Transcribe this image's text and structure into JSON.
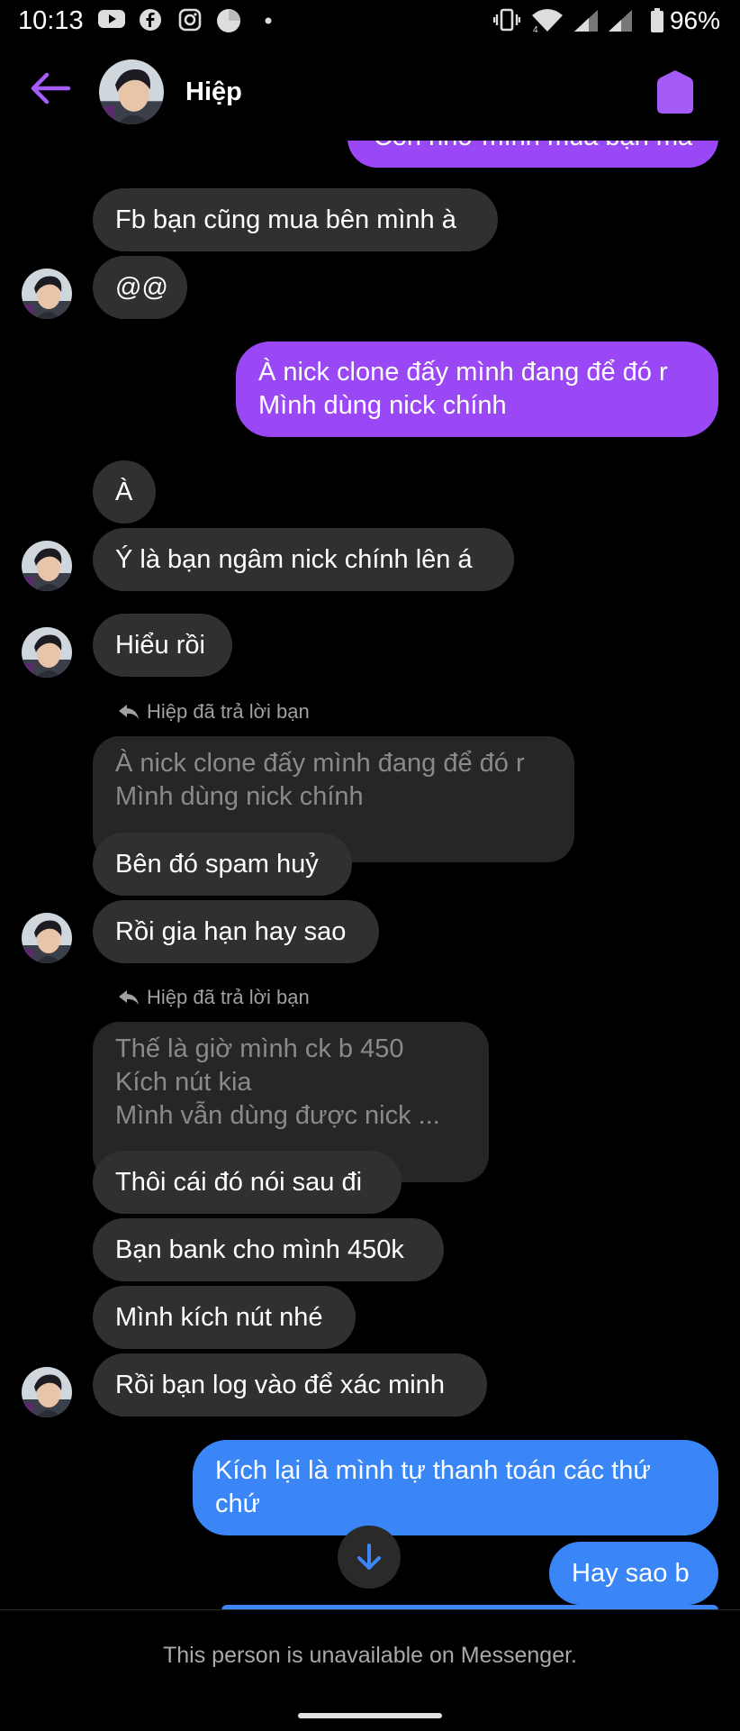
{
  "status_bar": {
    "time": "10:13",
    "battery": "96%",
    "icons": [
      "youtube-icon",
      "facebook-icon",
      "instagram-icon",
      "circle-icon",
      "dot-icon",
      "vibrate-icon",
      "wifi-icon",
      "signal-icon",
      "signal-icon",
      "battery-icon"
    ]
  },
  "header": {
    "contact_name": "Hiệp"
  },
  "top_partial": {
    "text": "Còn nhờ mình mua bạn mà"
  },
  "messages": [
    {
      "text": "Fb bạn cũng mua bên mình à"
    },
    {
      "text": "@@"
    },
    {
      "text": "À nick clone đấy mình đang để đó r\nMình dùng nick chính"
    },
    {
      "text": "À"
    },
    {
      "text": "Ý là bạn ngâm nick chính lên á"
    },
    {
      "text": "Hiểu rồi"
    },
    {
      "text": "Bên đó spam huỷ"
    },
    {
      "text": "Rồi gia hạn hay sao"
    },
    {
      "text": "Thôi cái đó nói sau đi"
    },
    {
      "text": "Bạn bank cho mình 450k"
    },
    {
      "text": "Mình kích nút nhé"
    },
    {
      "text": "Rồi bạn log vào để xác minh"
    },
    {
      "text": "Kích lại là mình tự thanh toán các thứ\nchứ"
    },
    {
      "text": "Hay sao b"
    }
  ],
  "replies": [
    {
      "label": "Hiệp đã trả lời bạn",
      "quoted": "À nick clone đấy mình đang để đó r\nMình dùng nick chính"
    },
    {
      "label": "Hiệp đã trả lời bạn",
      "quoted": "Thế là giờ mình ck b 450\nKích nút kia\nMình vẫn dùng được nick ..."
    }
  ],
  "footer": {
    "notice": "This person is unavailable on Messenger."
  },
  "colors": {
    "accent": "#9a47f5",
    "sent_blue": "#3a86f7",
    "received": "#303030"
  }
}
